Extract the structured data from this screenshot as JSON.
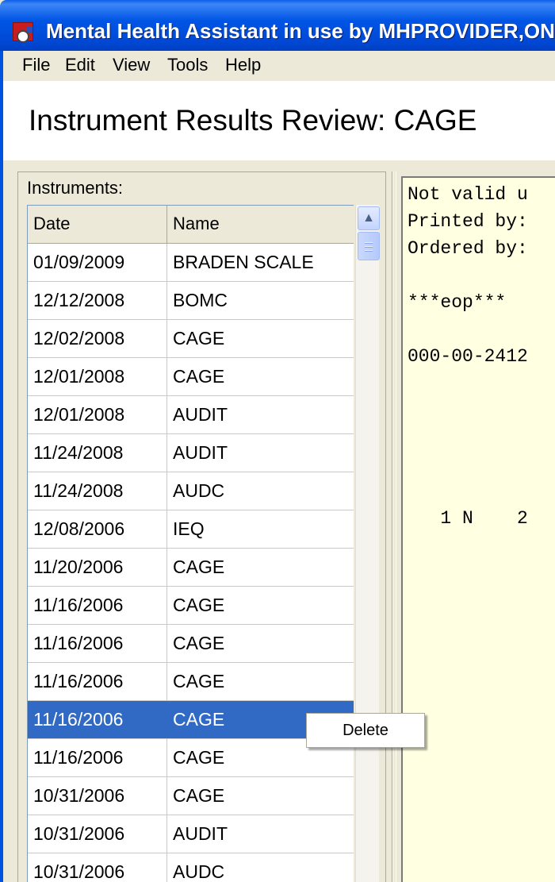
{
  "window": {
    "title": "Mental Health Assistant in use by MHPROVIDER,ONE"
  },
  "menu": [
    "File",
    "Edit",
    "View",
    "Tools",
    "Help"
  ],
  "page_title": "Instrument Results Review: CAGE",
  "instruments": {
    "label": "Instruments:",
    "columns": [
      "Date",
      "Name"
    ],
    "rows": [
      {
        "date": "01/09/2009",
        "name": "BRADEN SCALE",
        "selected": false
      },
      {
        "date": "12/12/2008",
        "name": "BOMC",
        "selected": false
      },
      {
        "date": "12/02/2008",
        "name": "CAGE",
        "selected": false
      },
      {
        "date": "12/01/2008",
        "name": "CAGE",
        "selected": false
      },
      {
        "date": "12/01/2008",
        "name": "AUDIT",
        "selected": false
      },
      {
        "date": "11/24/2008",
        "name": "AUDIT",
        "selected": false
      },
      {
        "date": "11/24/2008",
        "name": "AUDC",
        "selected": false
      },
      {
        "date": "12/08/2006",
        "name": "IEQ",
        "selected": false
      },
      {
        "date": "11/20/2006",
        "name": "CAGE",
        "selected": false
      },
      {
        "date": "11/16/2006",
        "name": "CAGE",
        "selected": false
      },
      {
        "date": "11/16/2006",
        "name": "CAGE",
        "selected": false
      },
      {
        "date": "11/16/2006",
        "name": "CAGE",
        "selected": false
      },
      {
        "date": "11/16/2006",
        "name": "CAGE",
        "selected": true
      },
      {
        "date": "11/16/2006",
        "name": "CAGE",
        "selected": false
      },
      {
        "date": "10/31/2006",
        "name": "CAGE",
        "selected": false
      },
      {
        "date": "10/31/2006",
        "name": "AUDIT",
        "selected": false
      },
      {
        "date": "10/31/2006",
        "name": "AUDC",
        "selected": false
      }
    ]
  },
  "report_lines": [
    "Not valid u",
    "Printed by:",
    "Ordered by:",
    "",
    "***eop***",
    "",
    "000-00-2412",
    "",
    "",
    "",
    "",
    "",
    "   1 N    2"
  ],
  "context_menu": {
    "items": [
      "Delete"
    ]
  },
  "colors": {
    "titlebar": "#0055e5",
    "selection": "#316ac5",
    "report_background": "#ffffe1"
  },
  "icons": {
    "app": "mha-app-icon",
    "scroll_up": "scroll-up-arrow-icon"
  }
}
